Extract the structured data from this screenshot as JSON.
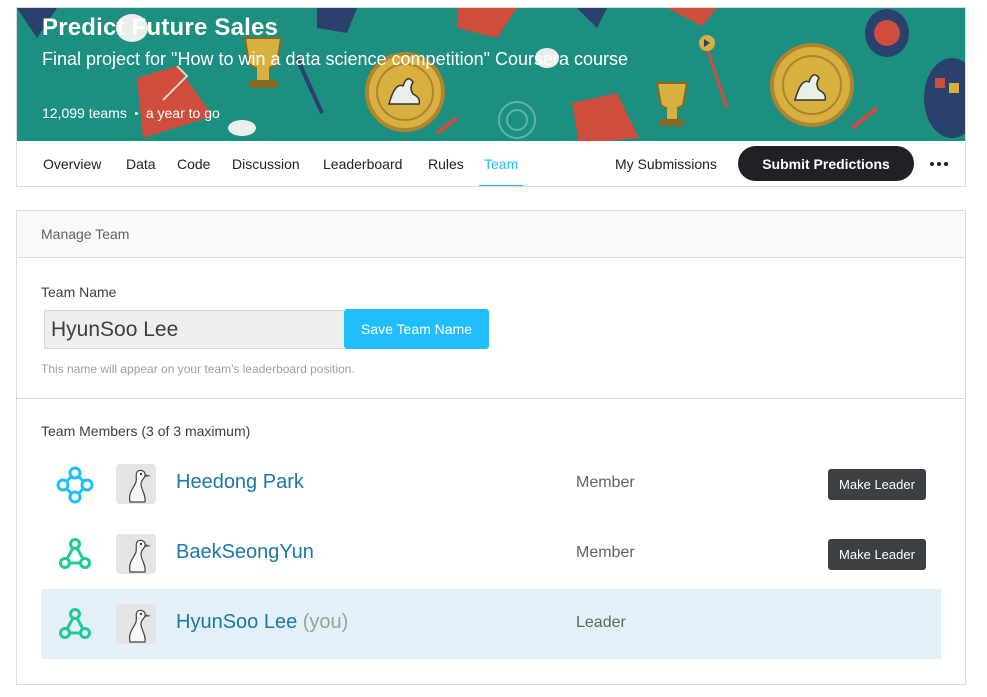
{
  "competition": {
    "title": "Predict Future Sales",
    "subtitle": "Final project for \"How to win a data science competition\" Coursera course",
    "teams_count": "12,099 teams",
    "deadline": "a year to go"
  },
  "tabs": [
    {
      "label": "Overview",
      "active": false
    },
    {
      "label": "Data",
      "active": false
    },
    {
      "label": "Code",
      "active": false
    },
    {
      "label": "Discussion",
      "active": false
    },
    {
      "label": "Leaderboard",
      "active": false
    },
    {
      "label": "Rules",
      "active": false
    },
    {
      "label": "Team",
      "active": true
    }
  ],
  "actions": {
    "my_submissions": "My Submissions",
    "submit_predictions": "Submit Predictions",
    "more_icon": "more-horizontal-icon"
  },
  "manage_team": {
    "header": "Manage Team",
    "team_name_label": "Team Name",
    "team_name_value": "HyunSoo Lee",
    "save_button": "Save Team Name",
    "hint": "This name will appear on your team's leaderboard position."
  },
  "members": {
    "title": "Team Members (3 of 3 maximum)",
    "list": [
      {
        "name": "Heedong Park",
        "you": "",
        "role": "Member",
        "action": "Make Leader",
        "tier_icon": "expert-tier-icon",
        "tier_color": "#20beff"
      },
      {
        "name": "BaekSeongYun",
        "you": "",
        "role": "Member",
        "action": "Make Leader",
        "tier_icon": "contributor-tier-icon",
        "tier_color": "#20c997"
      },
      {
        "name": "HyunSoo Lee",
        "you": "(you)",
        "role": "Leader",
        "action": "",
        "tier_icon": "contributor-tier-icon",
        "tier_color": "#20c997"
      }
    ]
  },
  "colors": {
    "accent": "#20beff",
    "banner": "#1d8f80",
    "link": "#1b78a8",
    "self_row": "#e3f0f7"
  }
}
